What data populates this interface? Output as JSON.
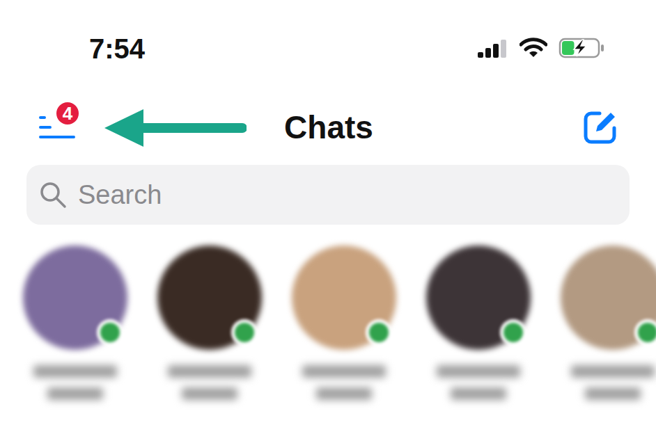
{
  "status_bar": {
    "time": "7:54",
    "signal_level": 0.75,
    "battery_charging": true,
    "battery_level": 0.35
  },
  "header": {
    "title": "Chats",
    "menu_badge": "4"
  },
  "search": {
    "placeholder": "Search"
  },
  "stories": [
    {
      "online": true,
      "color": "#7d6c9e"
    },
    {
      "online": true,
      "color": "#3a2b24"
    },
    {
      "online": true,
      "color": "#c9a27e"
    },
    {
      "online": true,
      "color": "#3d3437"
    },
    {
      "online": true,
      "color": "#b39a82"
    }
  ]
}
